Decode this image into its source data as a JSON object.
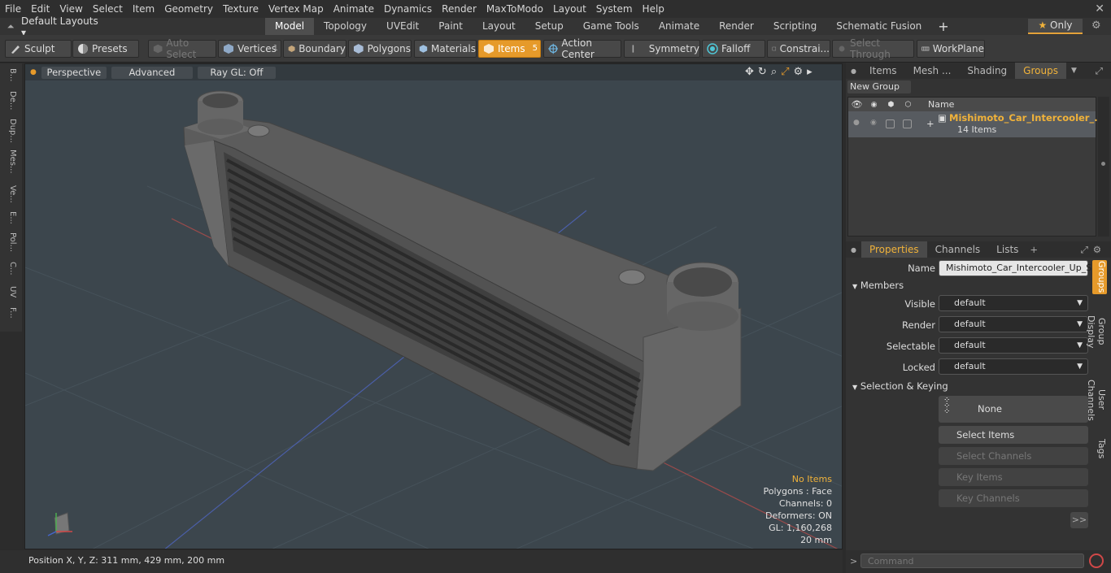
{
  "menu": [
    "File",
    "Edit",
    "View",
    "Select",
    "Item",
    "Geometry",
    "Texture",
    "Vertex Map",
    "Animate",
    "Dynamics",
    "Render",
    "MaxToModo",
    "Layout",
    "System",
    "Help"
  ],
  "layout": {
    "default_layouts": "Default Layouts ▾"
  },
  "tabs": [
    "Model",
    "Topology",
    "UVEdit",
    "Paint",
    "Layout",
    "Setup",
    "Game Tools",
    "Animate",
    "Render",
    "Scripting",
    "Schematic Fusion"
  ],
  "only_label": "Only",
  "toolbar": {
    "sculpt": "Sculpt",
    "presets": "Presets",
    "auto_select": "Auto Select",
    "vertices": "Vertices",
    "vertices_count": "1",
    "boundary": "Boundary",
    "polygons": "Polygons",
    "materials": "Materials",
    "items": "Items",
    "items_count": "5",
    "action_center": "Action Center",
    "symmetry": "Symmetry",
    "falloff": "Falloff",
    "constraints": "Constrai...",
    "select_through": "Select Through",
    "workplane": "WorkPlane"
  },
  "left_tools": [
    "B...",
    "De...",
    "Dup...",
    "Mes...",
    "Ve...",
    "E...",
    "Pol...",
    "C...",
    "UV",
    "F..."
  ],
  "viewport": {
    "perspective": "Perspective",
    "advanced": "Advanced",
    "raygl": "Ray GL: Off",
    "hud": [
      "No Items",
      "Polygons : Face",
      "Channels: 0",
      "Deformers: ON",
      "GL: 1,160,268",
      "20 mm"
    ]
  },
  "status": {
    "position": "Position X, Y, Z:   311 mm, 429 mm, 200 mm"
  },
  "groups_panel": {
    "tabs": [
      "Items",
      "Mesh ...",
      "Shading",
      "Groups"
    ],
    "new_group": "New Group",
    "col_name": "Name",
    "group_name": "Mishimoto_Car_Intercooler_...",
    "group_sub": "14 Items"
  },
  "props_panel": {
    "tabs": [
      "Properties",
      "Channels",
      "Lists"
    ],
    "name_label": "Name",
    "name_value": "Mishimoto_Car_Intercooler_Up_Side",
    "members": "Members",
    "rows": [
      {
        "label": "Visible",
        "value": "default"
      },
      {
        "label": "Render",
        "value": "default"
      },
      {
        "label": "Selectable",
        "value": "default"
      },
      {
        "label": "Locked",
        "value": "default"
      }
    ],
    "sel_keying": "Selection & Keying",
    "none": "None",
    "select_items": "Select Items",
    "select_channels": "Select Channels",
    "key_items": "Key Items",
    "key_channels": "Key Channels",
    "more": ">>"
  },
  "side_tabs": [
    "Groups",
    "Group Display",
    "User Channels",
    "Tags"
  ],
  "command_placeholder": "Command",
  "colors": {
    "accent": "#e69a2a",
    "viewport_bg": "#3c464d"
  }
}
